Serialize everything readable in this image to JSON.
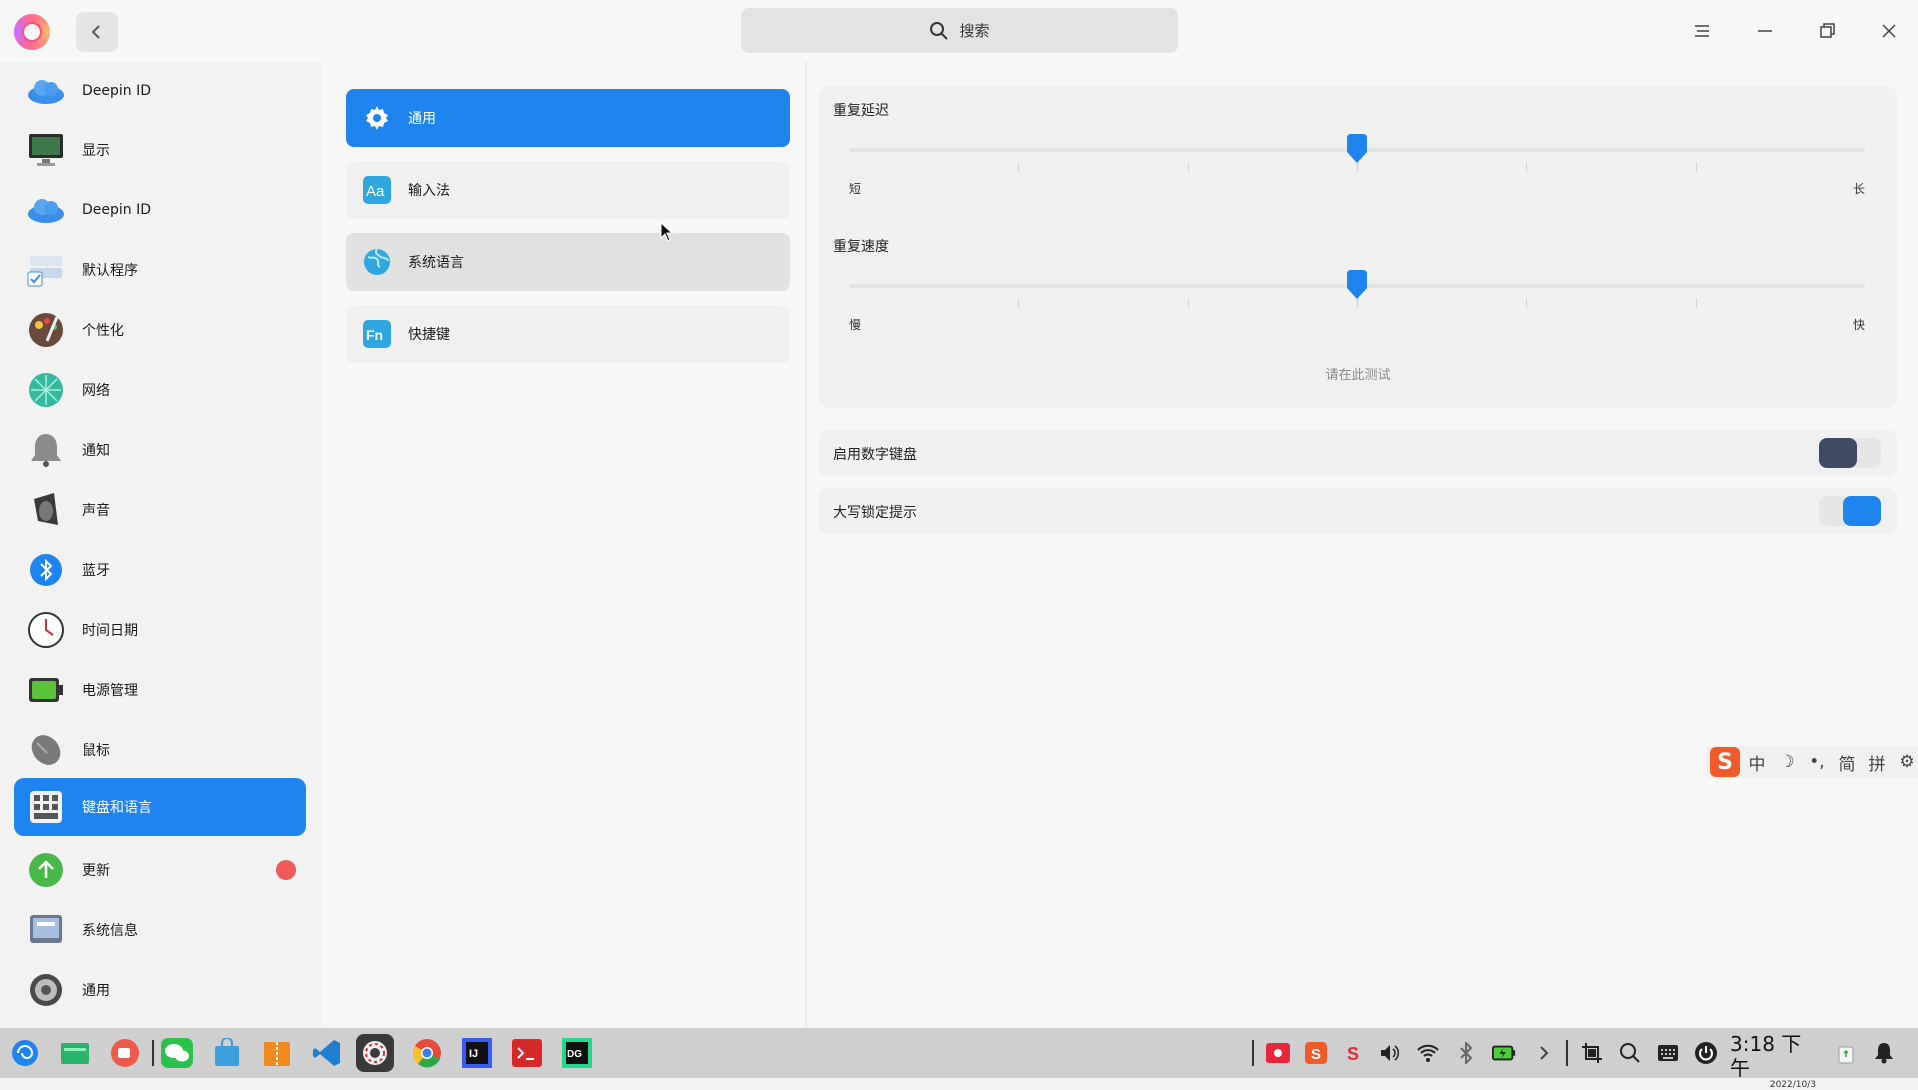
{
  "search": {
    "placeholder": "搜索"
  },
  "sidebar": {
    "items": [
      {
        "label": "Deepin ID",
        "icon": "cloud-icon"
      },
      {
        "label": "显示",
        "icon": "monitor-icon"
      },
      {
        "label": "Deepin ID",
        "icon": "cloud-icon"
      },
      {
        "label": "默认程序",
        "icon": "default-apps-icon"
      },
      {
        "label": "个性化",
        "icon": "palette-icon"
      },
      {
        "label": "网络",
        "icon": "network-icon"
      },
      {
        "label": "通知",
        "icon": "bell-icon"
      },
      {
        "label": "声音",
        "icon": "speaker-icon"
      },
      {
        "label": "蓝牙",
        "icon": "bluetooth-icon"
      },
      {
        "label": "时间日期",
        "icon": "clock-icon"
      },
      {
        "label": "电源管理",
        "icon": "battery-icon"
      },
      {
        "label": "鼠标",
        "icon": "mouse-icon"
      },
      {
        "label": "键盘和语言",
        "icon": "keyboard-icon",
        "active": true
      },
      {
        "label": "更新",
        "icon": "update-icon",
        "badge": true
      },
      {
        "label": "系统信息",
        "icon": "system-info-icon"
      },
      {
        "label": "通用",
        "icon": "general-icon"
      }
    ]
  },
  "middle": {
    "items": [
      {
        "label": "通用",
        "icon": "gear-icon"
      },
      {
        "label": "输入法",
        "icon": "input-method-icon"
      },
      {
        "label": "系统语言",
        "icon": "globe-icon"
      },
      {
        "label": "快捷键",
        "icon": "fn-key-icon"
      }
    ]
  },
  "content": {
    "repeat_delay": {
      "title": "重复延迟",
      "min_label": "短",
      "max_label": "长",
      "value": 0.5
    },
    "repeat_rate": {
      "title": "重复速度",
      "min_label": "慢",
      "max_label": "快",
      "value": 0.5
    },
    "test_placeholder": "请在此测试",
    "numlock": {
      "label": "启用数字键盘",
      "enabled": false
    },
    "capslock": {
      "label": "大写锁定提示",
      "enabled": true
    }
  },
  "ime": {
    "items": [
      "中",
      "☽",
      "•,",
      "简",
      "拼",
      "⚙"
    ]
  },
  "taskbar": {
    "clock_time": "3:18 下午",
    "clock_date": "2022/10/3"
  },
  "colors": {
    "accent": "#1e84f0",
    "toggle_off": "#3e4a63",
    "badge": "#ef5a5a"
  }
}
